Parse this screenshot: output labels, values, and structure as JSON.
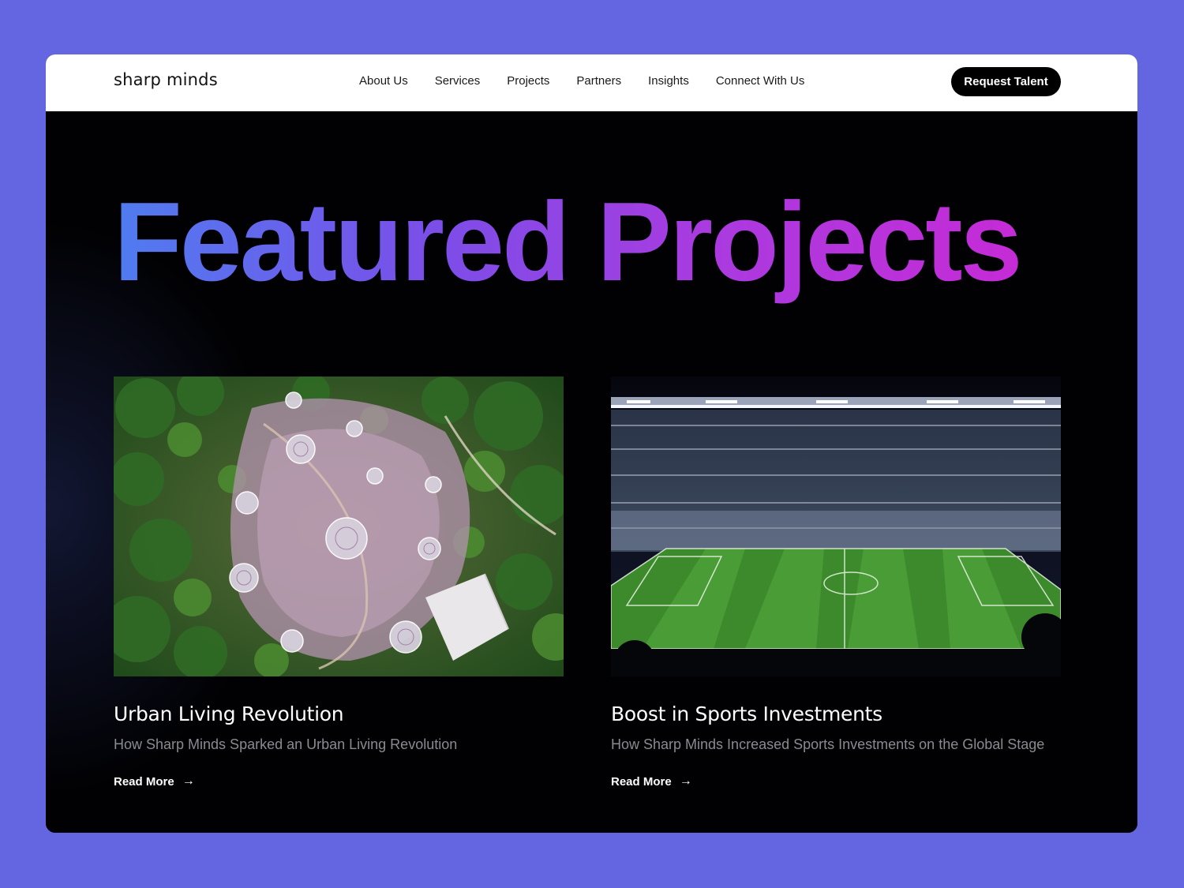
{
  "brand": {
    "logo_text": "sharp minds"
  },
  "nav": {
    "links": [
      "About Us",
      "Services",
      "Projects",
      "Partners",
      "Insights",
      "Connect With Us"
    ],
    "cta_label": "Request Talent"
  },
  "hero": {
    "headline": "Featured Projects"
  },
  "projects": [
    {
      "title": "Urban Living Revolution",
      "subtitle": "How Sharp Minds Sparked an Urban Living Revolution",
      "link_label": "Read More",
      "image": "aerial-garden-supertrees"
    },
    {
      "title": "Boost in Sports Investments",
      "subtitle": "How Sharp Minds Increased Sports Investments on the Global Stage",
      "link_label": "Read More",
      "image": "football-stadium-night"
    }
  ],
  "colors": {
    "page_background": "#6366e0",
    "headline_gradient_start": "#4f7cf0",
    "headline_gradient_end": "#c52bd6",
    "hero_background": "#010103"
  }
}
